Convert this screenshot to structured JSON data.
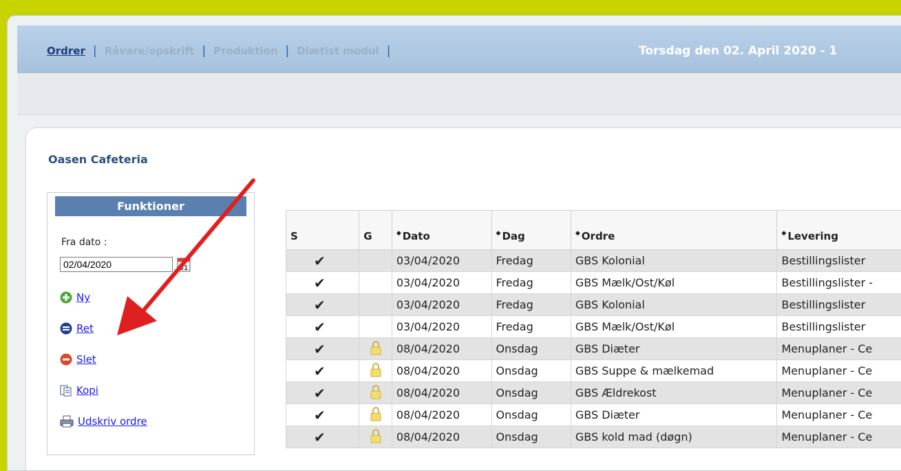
{
  "nav": {
    "items": [
      {
        "label": "Ordrer",
        "active": true
      },
      {
        "label": "Råvare/opskrift",
        "active": false
      },
      {
        "label": "Produktion",
        "active": false
      },
      {
        "label": "Diætist modul",
        "active": false
      }
    ],
    "date_text": "Torsdag den 02. April 2020 -  1"
  },
  "company": "Oasen Cafeteria",
  "functions": {
    "header": "Funktioner",
    "from_label": "Fra dato :",
    "from_value": "02/04/2020",
    "calendar_day": "31",
    "actions": [
      {
        "label": "Ny",
        "icon": "add-icon"
      },
      {
        "label": "Ret",
        "icon": "edit-icon"
      },
      {
        "label": "Slet",
        "icon": "delete-icon"
      },
      {
        "label": "Kopi",
        "icon": "copy-icon"
      },
      {
        "label": "Udskriv ordre",
        "icon": "print-icon"
      }
    ]
  },
  "table": {
    "columns": [
      "S",
      "G",
      "Dato",
      "Dag",
      "Ordre",
      "Levering"
    ],
    "rows": [
      {
        "s": "✔",
        "locked": false,
        "dato": "03/04/2020",
        "dag": "Fredag",
        "ordre": "GBS Kolonial",
        "levering": "Bestillingslister"
      },
      {
        "s": "✔",
        "locked": false,
        "dato": "03/04/2020",
        "dag": "Fredag",
        "ordre": "GBS Mælk/Ost/Køl",
        "levering": "Bestillingslister -"
      },
      {
        "s": "✔",
        "locked": false,
        "dato": "03/04/2020",
        "dag": "Fredag",
        "ordre": "GBS Kolonial",
        "levering": "Bestillingslister"
      },
      {
        "s": "✔",
        "locked": false,
        "dato": "03/04/2020",
        "dag": "Fredag",
        "ordre": "GBS Mælk/Ost/Køl",
        "levering": "Bestillingslister"
      },
      {
        "s": "✔",
        "locked": true,
        "dato": "08/04/2020",
        "dag": "Onsdag",
        "ordre": "GBS Diæter",
        "levering": "Menuplaner - Ce"
      },
      {
        "s": "✔",
        "locked": true,
        "dato": "08/04/2020",
        "dag": "Onsdag",
        "ordre": "GBS Suppe & mælkemad",
        "levering": "Menuplaner - Ce"
      },
      {
        "s": "✔",
        "locked": true,
        "dato": "08/04/2020",
        "dag": "Onsdag",
        "ordre": "GBS Ældrekost",
        "levering": "Menuplaner - Ce"
      },
      {
        "s": "✔",
        "locked": true,
        "dato": "08/04/2020",
        "dag": "Onsdag",
        "ordre": "GBS Diæter",
        "levering": "Menuplaner - Ce"
      },
      {
        "s": "✔",
        "locked": true,
        "dato": "08/04/2020",
        "dag": "Onsdag",
        "ordre": "GBS kold mad (døgn)",
        "levering": "Menuplaner - Ce"
      }
    ]
  },
  "colors": {
    "background": "#c8d400",
    "accent": "#5a80b0",
    "arrow": "#e02020",
    "check": "#2e8b2e"
  }
}
